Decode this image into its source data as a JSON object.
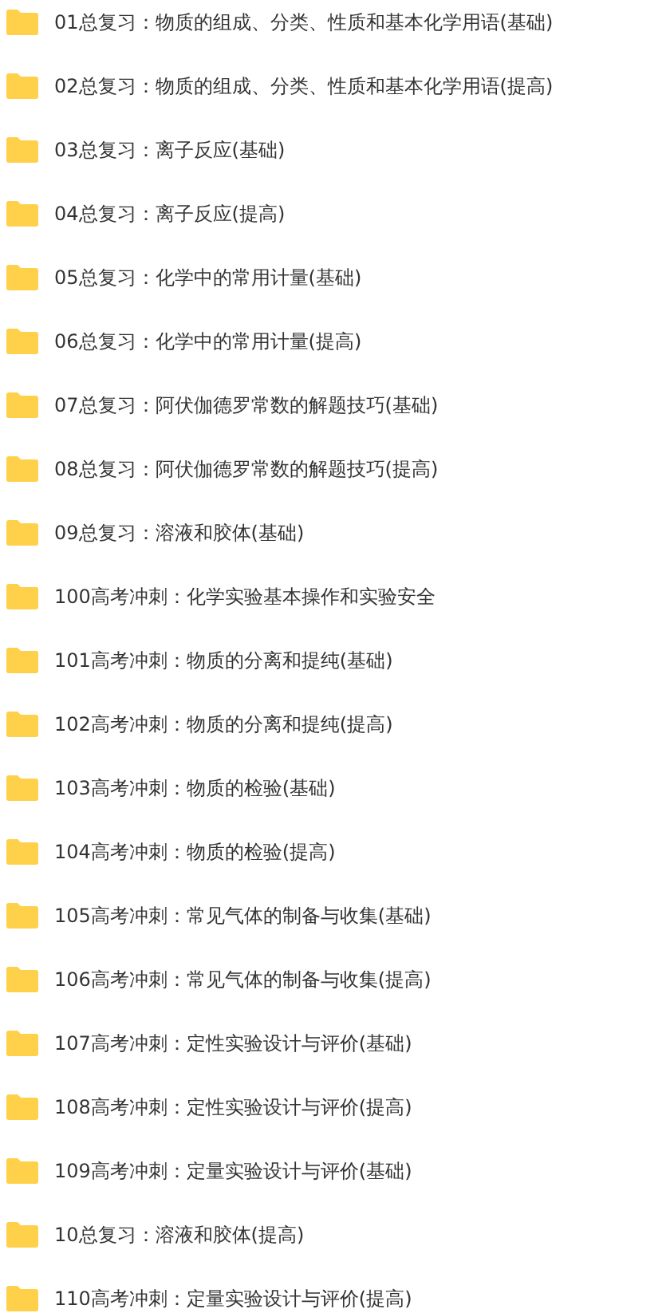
{
  "folders": [
    {
      "name": "01总复习：物质的组成、分类、性质和基本化学用语(基础)"
    },
    {
      "name": "02总复习：物质的组成、分类、性质和基本化学用语(提高)"
    },
    {
      "name": "03总复习：离子反应(基础)"
    },
    {
      "name": "04总复习：离子反应(提高)"
    },
    {
      "name": "05总复习：化学中的常用计量(基础)"
    },
    {
      "name": "06总复习：化学中的常用计量(提高)"
    },
    {
      "name": "07总复习：阿伏伽德罗常数的解题技巧(基础)"
    },
    {
      "name": "08总复习：阿伏伽德罗常数的解题技巧(提高)"
    },
    {
      "name": "09总复习：溶液和胶体(基础)"
    },
    {
      "name": "100高考冲刺：化学实验基本操作和实验安全"
    },
    {
      "name": "101高考冲刺：物质的分离和提纯(基础)"
    },
    {
      "name": "102高考冲刺：物质的分离和提纯(提高)"
    },
    {
      "name": "103高考冲刺：物质的检验(基础)"
    },
    {
      "name": "104高考冲刺：物质的检验(提高)"
    },
    {
      "name": "105高考冲刺：常见气体的制备与收集(基础)"
    },
    {
      "name": "106高考冲刺：常见气体的制备与收集(提高)"
    },
    {
      "name": "107高考冲刺：定性实验设计与评价(基础)"
    },
    {
      "name": "108高考冲刺：定性实验设计与评价(提高)"
    },
    {
      "name": "109高考冲刺：定量实验设计与评价(基础)"
    },
    {
      "name": "10总复习：溶液和胶体(提高)"
    },
    {
      "name": "110高考冲刺：定量实验设计与评价(提高)"
    }
  ]
}
